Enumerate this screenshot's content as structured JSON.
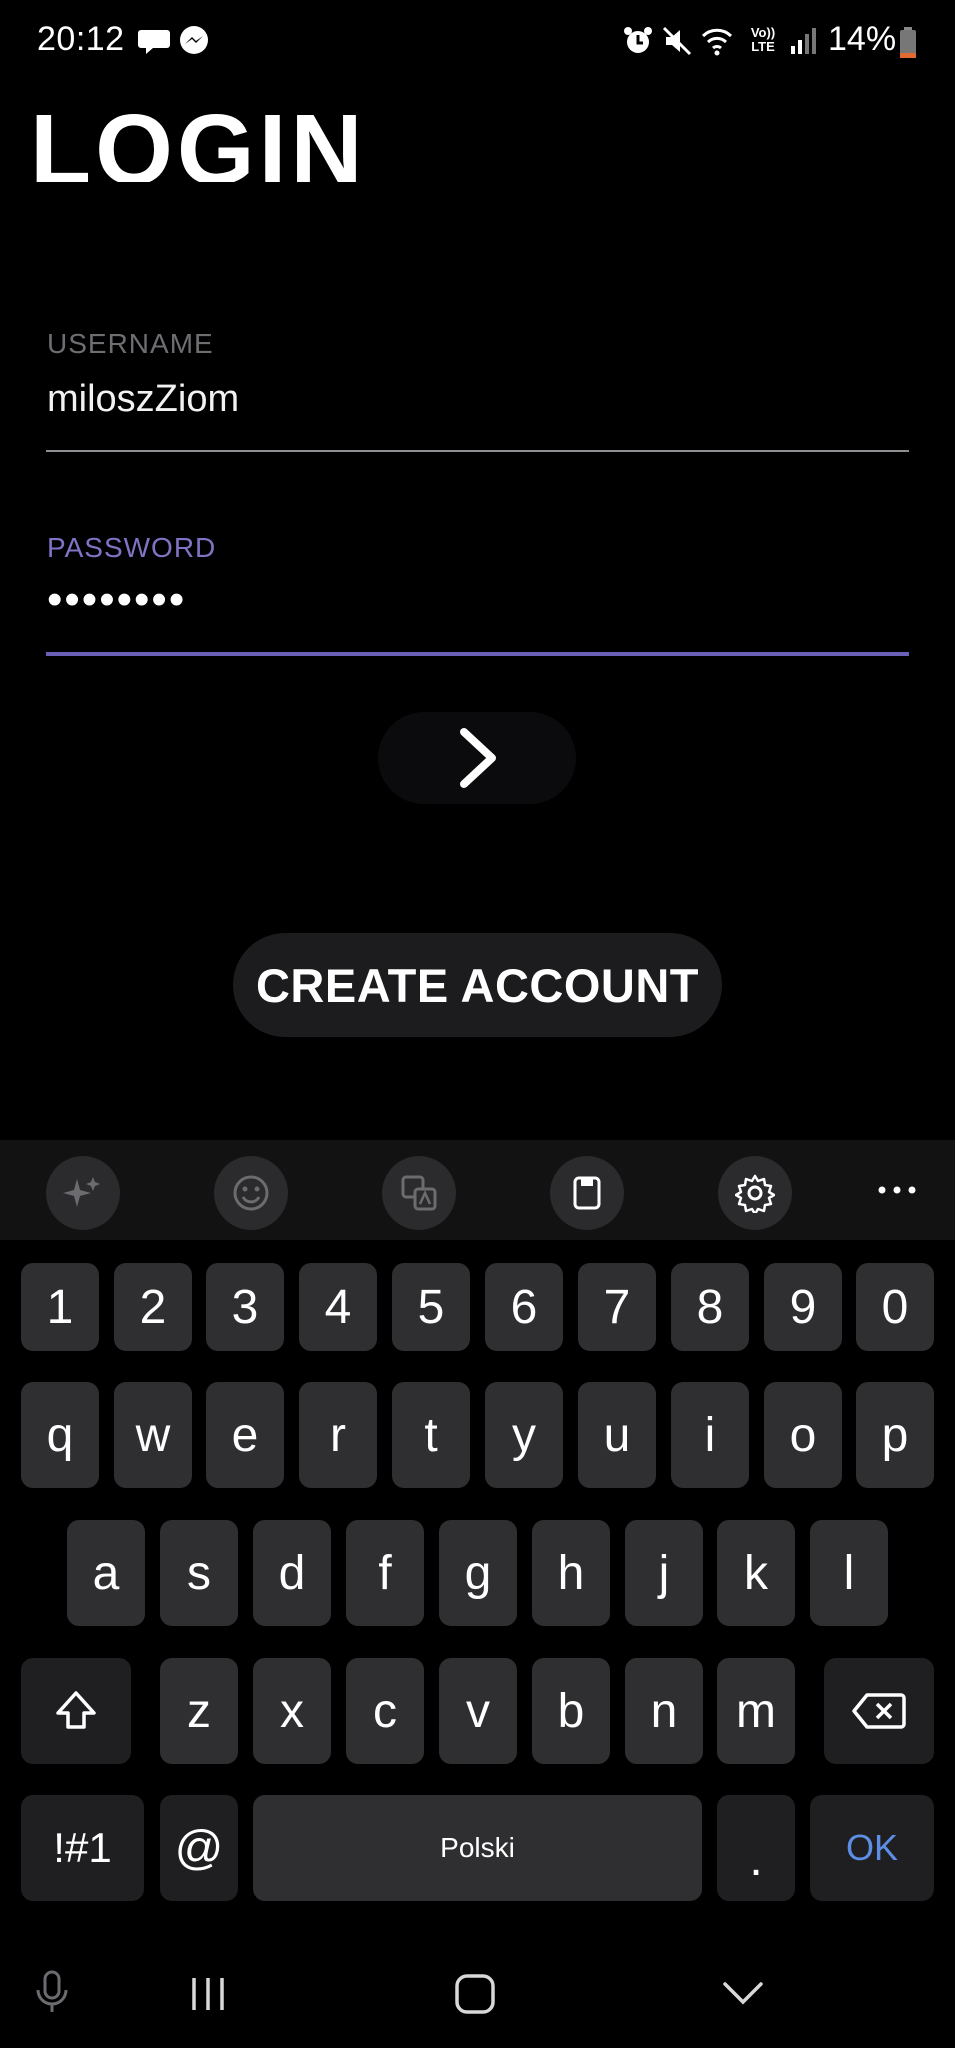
{
  "status_bar": {
    "time": "20:12",
    "battery": "14%",
    "icons": [
      "speech-bubble-icon",
      "messenger-icon",
      "alarm-icon",
      "mute-icon",
      "wifi-icon",
      "volte-icon",
      "signal-icon",
      "battery-icon"
    ],
    "volte_text": "Vo))\nLTE"
  },
  "page": {
    "title": "LOGIN",
    "username_label": "USERNAME",
    "username_value": "miloszZiom",
    "password_label": "PASSWORD",
    "password_value": "••••••••",
    "submit_icon": "chevron-right-icon",
    "create_account_label": "CREATE ACCOUNT"
  },
  "keyboard": {
    "toolbar_icons": [
      "sparkle-icon",
      "emoji-icon",
      "translate-icon",
      "clipboard-icon",
      "gear-icon",
      "more-icon"
    ],
    "number_row": [
      "1",
      "2",
      "3",
      "4",
      "5",
      "6",
      "7",
      "8",
      "9",
      "0"
    ],
    "row1": [
      "q",
      "w",
      "e",
      "r",
      "t",
      "y",
      "u",
      "i",
      "o",
      "p"
    ],
    "row2": [
      "a",
      "s",
      "d",
      "f",
      "g",
      "h",
      "j",
      "k",
      "l"
    ],
    "row3": [
      "z",
      "x",
      "c",
      "v",
      "b",
      "n",
      "m"
    ],
    "symbols_key": "!#1",
    "at_key": "@",
    "space_label": "Polski",
    "period_key": ".",
    "ok_key": "OK",
    "ok_color": "#5c8ee6"
  },
  "nav_bar": {
    "icons": [
      "microphone-icon",
      "recent-apps-icon",
      "home-icon",
      "back-icon"
    ]
  }
}
